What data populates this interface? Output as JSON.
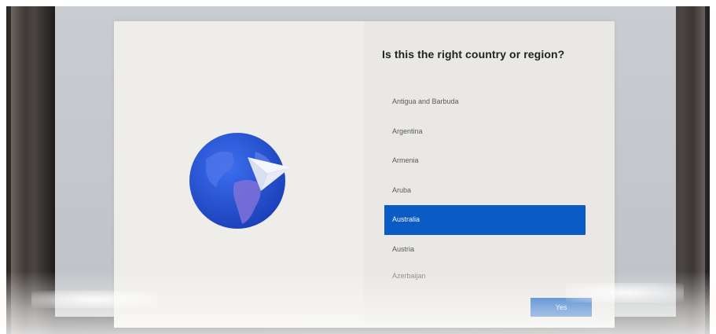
{
  "setup": {
    "question": "Is this the right country or region?",
    "illustration_icon": "globe-paper-plane-icon",
    "countries": [
      {
        "label": "Antigua and Barbuda",
        "selected": false
      },
      {
        "label": "Argentina",
        "selected": false
      },
      {
        "label": "Armenia",
        "selected": false
      },
      {
        "label": "Aruba",
        "selected": false
      },
      {
        "label": "Australia",
        "selected": true
      },
      {
        "label": "Austria",
        "selected": false
      },
      {
        "label": "Azerbaijan",
        "selected": false
      }
    ],
    "primary_button_label": "Yes"
  },
  "colors": {
    "accent": "#0a5bc4",
    "panel_background": "#e9e8e5",
    "globe_blue": "#1f4fd0"
  }
}
